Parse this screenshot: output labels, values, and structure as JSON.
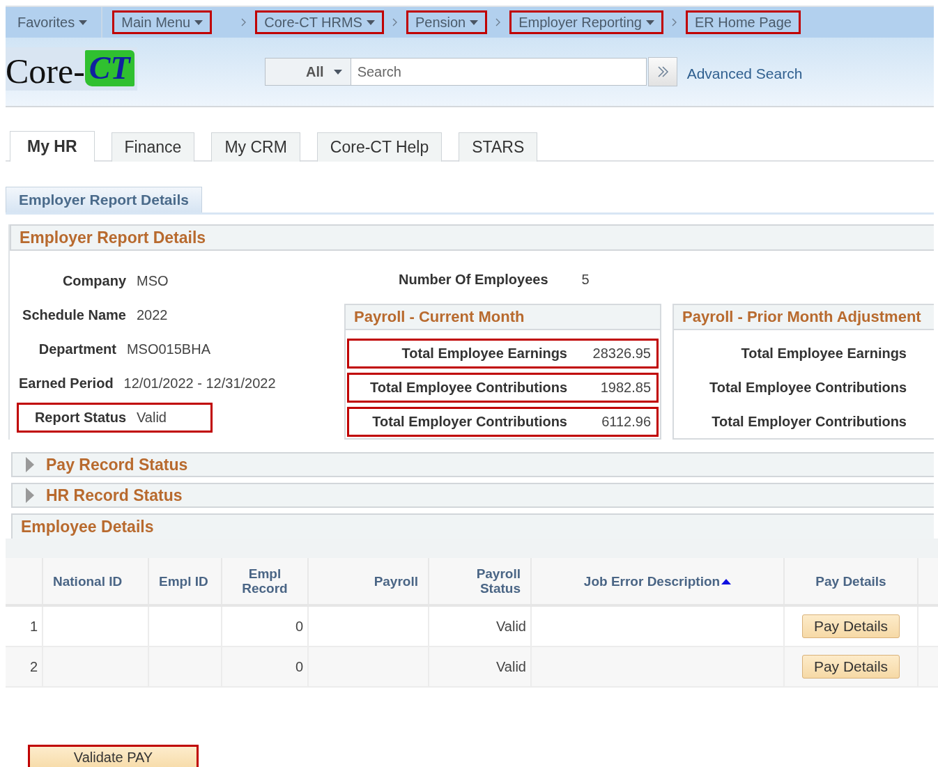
{
  "nav": {
    "favorites": {
      "label": "Favorites"
    },
    "breadcrumbs": [
      {
        "label": "Main Menu",
        "dropdown": true,
        "highlighted": true
      },
      {
        "label": "Core-CT HRMS",
        "dropdown": true,
        "highlighted": true
      },
      {
        "label": "Pension",
        "dropdown": true,
        "highlighted": true
      },
      {
        "label": "Employer Reporting",
        "dropdown": true,
        "highlighted": true
      },
      {
        "label": "ER Home Page",
        "dropdown": false,
        "highlighted": true
      }
    ]
  },
  "logo": {
    "text": "Core-",
    "mark": "CT"
  },
  "search": {
    "scope": "All",
    "placeholder": "Search",
    "advanced_link": "Advanced Search"
  },
  "tabs": [
    {
      "label": "My HR",
      "selected": true
    },
    {
      "label": "Finance",
      "selected": false
    },
    {
      "label": "My CRM",
      "selected": false
    },
    {
      "label": "Core-CT Help",
      "selected": false
    },
    {
      "label": "STARS",
      "selected": false
    }
  ],
  "page_tab": {
    "label": "Employer Report Details"
  },
  "section": {
    "title": "Employer Report Details",
    "fields": [
      {
        "label": "Company",
        "value": "MSO",
        "highlighted": false
      },
      {
        "label": "Schedule Name",
        "value": "2022",
        "highlighted": false
      },
      {
        "label": "Department",
        "value": "MSO015BHA",
        "highlighted": false
      },
      {
        "label": "Earned Period",
        "value": "12/01/2022 - 12/31/2022",
        "highlighted": false
      },
      {
        "label": "Report Status",
        "value": "Valid",
        "highlighted": true
      }
    ],
    "employees": {
      "label": "Number Of Employees",
      "value": "5"
    },
    "payroll_current": {
      "title": "Payroll - Current Month",
      "rows": [
        {
          "label": "Total Employee Earnings",
          "value": "28326.95",
          "highlighted": true
        },
        {
          "label": "Total Employee Contributions",
          "value": "1982.85",
          "highlighted": true
        },
        {
          "label": "Total Employer Contributions",
          "value": "6112.96",
          "highlighted": true
        }
      ]
    },
    "payroll_prior": {
      "title": "Payroll - Prior Month Adjustment",
      "rows": [
        {
          "label": "Total Employee Earnings",
          "highlighted": false
        },
        {
          "label": "Total Employee Contributions",
          "highlighted": false
        },
        {
          "label": "Total Employer Contributions",
          "highlighted": false
        }
      ]
    }
  },
  "collapsibles": [
    {
      "title": "Pay Record Status",
      "expanded": false
    },
    {
      "title": "HR Record Status",
      "expanded": false
    }
  ],
  "employee_details": {
    "title": "Employee Details",
    "table": {
      "columns": [
        {
          "label": "National ID",
          "sorted": false
        },
        {
          "label": "Empl ID",
          "sorted": false
        },
        {
          "label": "Empl Record",
          "sorted": false
        },
        {
          "label": "Payroll",
          "sorted": false
        },
        {
          "label": "Payroll Status",
          "sorted": false
        },
        {
          "label": "Job Error Description",
          "sorted": true
        },
        {
          "label": "Pay Details",
          "sorted": false
        }
      ],
      "rows": [
        {
          "number": "1",
          "empl_record": "0",
          "payroll_status": "Valid",
          "pay_button": "Pay Details"
        },
        {
          "number": "2",
          "empl_record": "0",
          "payroll_status": "Valid",
          "pay_button": "Pay Details"
        }
      ]
    }
  },
  "validate_button": {
    "label": "Validate PAY",
    "highlighted": true
  }
}
